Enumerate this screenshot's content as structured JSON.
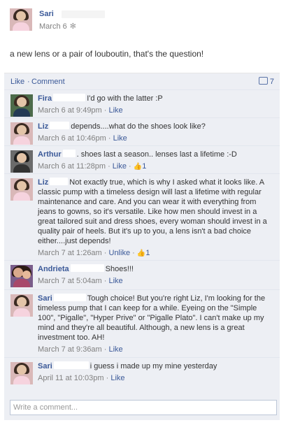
{
  "post": {
    "author": "Sari",
    "date": "March 6",
    "privacy_icon": "gear-icon",
    "text": "a new lens or a pair of louboutin, that's the question!"
  },
  "ufi": {
    "like_label": "Like",
    "separator": "·",
    "comment_label": "Comment",
    "comment_count": "7"
  },
  "comments": [
    {
      "name": "Fira",
      "text": "I'd go with the latter :P",
      "date": "March 6 at 9:49pm",
      "like": "Like"
    },
    {
      "name": "Liz",
      "text": "depends....what do the shoes look like?",
      "date": "March 6 at 10:46pm",
      "like": "Like"
    },
    {
      "name": "Arthur",
      "text": ". shoes last a season.. lenses last a lifetime :-D",
      "date": "March 6 at 11:28pm",
      "like": "Like",
      "likes": "1"
    },
    {
      "name": "Liz",
      "text": "Not exactly true, which is why I asked what it looks like. A classic pump with a timeless design will last a lifetime with regular maintenance and care. And you can wear it with everything from jeans to gowns, so it's versatile. Like how men should invest in a great tailored suit and dress shoes, every woman should invest in a quality pair of heels. But it's up to you, a lens isn't a bad choice either....just depends!",
      "date": "March 7 at 1:26am",
      "like": "Unlike",
      "likes": "1"
    },
    {
      "name": "Andrieta",
      "text": "Shoes!!!",
      "date": "March 7 at 5:04am",
      "like": "Like"
    },
    {
      "name": "Sari",
      "text": "Tough choice! But you're right Liz, I'm looking for the timeless pump that I can keep for a while. Eyeing on the \"Simple 100\", \"Pigalle\", \"Hyper Prive\" or \"Pigalle Plato\". I can't make up my mind and they're all beautiful. Although, a new lens is a great investment too. AH!",
      "date": "March 7 at 9:36am",
      "like": "Like"
    },
    {
      "name": "Sari",
      "text": "i guess i made up my mine yesterday",
      "date": "April 11 at 10:03pm",
      "like": "Like"
    }
  ],
  "write_comment": {
    "placeholder": "Write a comment..."
  }
}
